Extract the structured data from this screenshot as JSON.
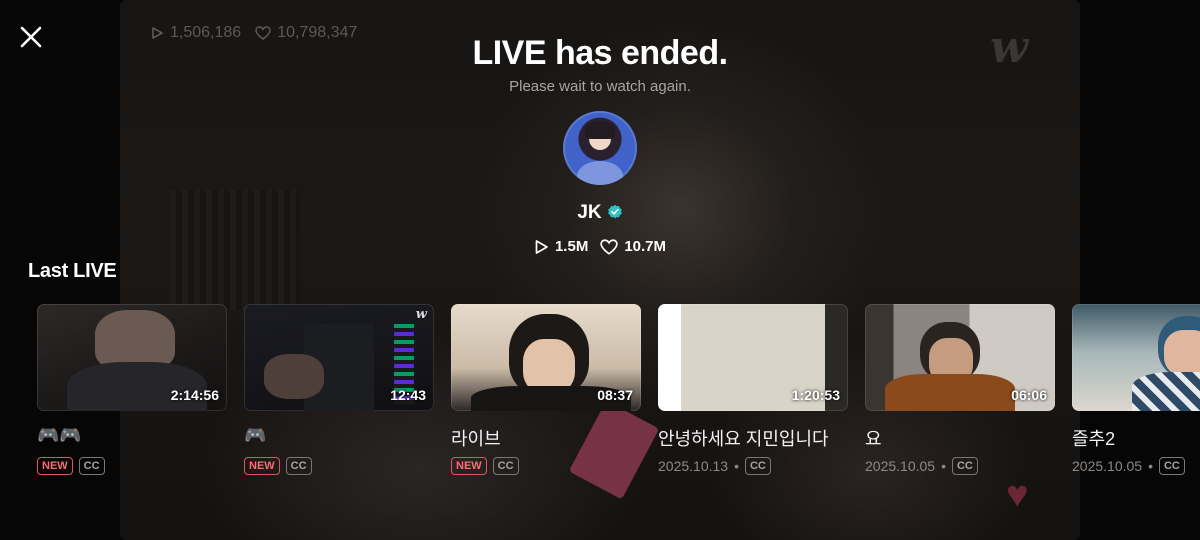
{
  "top_stats": {
    "plays": "1,506,186",
    "likes": "10,798,347"
  },
  "brand_watermark": "w",
  "header": {
    "title": "LIVE has ended.",
    "subtitle": "Please wait to watch again."
  },
  "artist": {
    "name": "JK",
    "verified": true,
    "plays": "1.5M",
    "likes": "10.7M"
  },
  "section_title": "Last LIVE",
  "cards": [
    {
      "duration": "2:14:56",
      "title": "🎮🎮",
      "date": "",
      "new": true,
      "cc": true,
      "new_label": "NEW",
      "cc_label": "CC"
    },
    {
      "duration": "12:43",
      "title": "🎮",
      "date": "",
      "new": true,
      "cc": true,
      "new_label": "NEW",
      "cc_label": "CC",
      "watermark": "w"
    },
    {
      "duration": "08:37",
      "title": "라이브",
      "date": "",
      "new": true,
      "cc": true,
      "new_label": "NEW",
      "cc_label": "CC"
    },
    {
      "duration": "1:20:53",
      "title": "안녕하세요 지민입니다",
      "date": "2025.10.13",
      "new": false,
      "cc": true,
      "cc_label": "CC"
    },
    {
      "duration": "06:06",
      "title": "요",
      "date": "2025.10.05",
      "new": false,
      "cc": true,
      "cc_label": "CC"
    },
    {
      "duration": "",
      "title": "즐추2",
      "date": "2025.10.05",
      "new": false,
      "cc": true,
      "cc_label": "CC"
    }
  ],
  "colors": {
    "background": "#060606",
    "new_badge": "#ff6b70",
    "verified": "#2fc3c9",
    "muted_text": "#8c8986"
  },
  "icons": [
    "close-icon",
    "play-icon",
    "heart-outline-icon",
    "verified-badge-icon",
    "weverse-logo-icon"
  ]
}
